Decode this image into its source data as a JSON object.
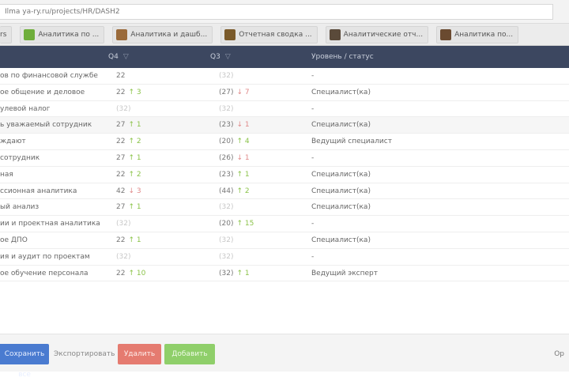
{
  "browser": {
    "url": "Ilma ya-ry.ru/projects/HR/DASH2"
  },
  "bookmarks": [
    {
      "label": "rs",
      "icon": "toolbar-icon",
      "color": ""
    },
    {
      "label": "Аналитика по ...",
      "icon": "leaf-icon",
      "color": "#6fae3b"
    },
    {
      "label": "Аналитика и дашб...",
      "icon": "image-icon",
      "color": "#9a6a3a"
    },
    {
      "label": "Отчетная сводка ...",
      "icon": "image-icon",
      "color": "#7a5a2a"
    },
    {
      "label": "Аналитические отч...",
      "icon": "image-icon",
      "color": "#5a4a3a"
    },
    {
      "label": "Аналитика по...",
      "icon": "image-icon",
      "color": "#6a4a30"
    }
  ],
  "table": {
    "headers": {
      "name": "",
      "col_a": "Q4",
      "col_b": "Q3",
      "col_c": "Уровень / статус"
    },
    "sort_indicator": "▽",
    "rows": [
      {
        "name": "ов по финансовой службе",
        "a": "22",
        "a_chg": "",
        "a_dir": "",
        "b": "(32)",
        "b_chg": "",
        "b_dir": "",
        "b_dim": true,
        "c": "-"
      },
      {
        "name": "ое общение и деловое",
        "a": "22",
        "a_chg": "↑ 3",
        "a_dir": "up",
        "b": "(27)",
        "b_chg": "↓ 7",
        "b_dir": "down",
        "b_dim": false,
        "c": "Специалист(ка)"
      },
      {
        "name": "улевой налог",
        "a": "(32)",
        "a_chg": "",
        "a_dir": "",
        "b": "(32)",
        "b_chg": "",
        "b_dir": "",
        "b_dim": true,
        "c": "-"
      },
      {
        "name": "ь уважаемый сотрудник",
        "a": "27",
        "a_chg": "↑ 1",
        "a_dir": "up",
        "b": "(23)",
        "b_chg": "↓ 1",
        "b_dir": "down",
        "b_dim": false,
        "c": "Специалист(ка)"
      },
      {
        "name": "ждают",
        "a": "22",
        "a_chg": "↑ 2",
        "a_dir": "up",
        "b": "(20)",
        "b_chg": "↑ 4",
        "b_dir": "up",
        "b_dim": false,
        "c": "Ведущий специалист"
      },
      {
        "name": "сотрудник",
        "a": "27",
        "a_chg": "↑ 1",
        "a_dir": "up",
        "b": "(26)",
        "b_chg": "↓ 1",
        "b_dir": "down",
        "b_dim": false,
        "c": "-"
      },
      {
        "name": "ная",
        "a": "22",
        "a_chg": "↑ 2",
        "a_dir": "up",
        "b": "(23)",
        "b_chg": "↑ 1",
        "b_dir": "up",
        "b_dim": false,
        "c": "Специалист(ка)"
      },
      {
        "name": "ссионная аналитика",
        "a": "42",
        "a_chg": "↓ 3",
        "a_dir": "down",
        "b": "(44)",
        "b_chg": "↑ 2",
        "b_dir": "up",
        "b_dim": false,
        "c": "Специалист(ка)"
      },
      {
        "name": "ый анализ",
        "a": "27",
        "a_chg": "↑ 1",
        "a_dir": "up",
        "b": "(32)",
        "b_chg": "",
        "b_dir": "",
        "b_dim": true,
        "c": "Специалист(ка)"
      },
      {
        "name": "ии и проектная аналитика",
        "a": "(32)",
        "a_chg": "",
        "a_dir": "",
        "b": "(20)",
        "b_chg": "↑ 15",
        "b_dir": "up",
        "b_dim": false,
        "c": "-"
      },
      {
        "name": "ое ДПО",
        "a": "22",
        "a_chg": "↑ 1",
        "a_dir": "up",
        "b": "(32)",
        "b_chg": "",
        "b_dir": "",
        "b_dim": true,
        "c": "Специалист(ка)"
      },
      {
        "name": "ия и аудит по проектам",
        "a": "(32)",
        "a_chg": "",
        "a_dir": "",
        "b": "(32)",
        "b_chg": "",
        "b_dir": "",
        "b_dim": true,
        "c": "-"
      },
      {
        "name": "ое обучение персонала",
        "a": "22",
        "a_chg": "↑ 10",
        "a_dir": "up",
        "b": "(32)",
        "b_chg": "↑ 1",
        "b_dir": "up",
        "b_dim": false,
        "c": "Ведущий эксперт"
      }
    ]
  },
  "footer": {
    "primary_button": "Сохранить все",
    "plain_button": "Экспортировать",
    "red_button": "Удалить",
    "green_button": "Добавить",
    "right_text": "Ор"
  },
  "colors": {
    "header_bg": "#3c4760",
    "up": "#8bc34a",
    "down": "#e08a8a",
    "primary": "#4a7bd0",
    "danger": "#e57b70",
    "success": "#8fcf6a"
  }
}
